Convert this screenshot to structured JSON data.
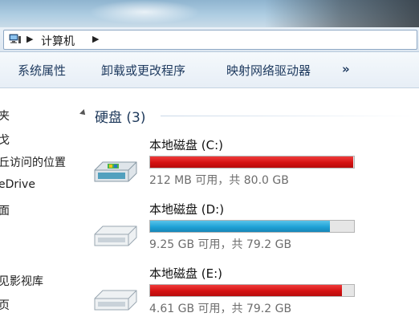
{
  "address": {
    "crumbs": [
      "计算机"
    ]
  },
  "toolbar": {
    "items": [
      "系统属性",
      "卸载或更改程序",
      "映射网络驱动器",
      "»"
    ]
  },
  "nav": {
    "items": [
      "夹",
      "戈",
      "丘访问的位置",
      "eDrive",
      "面",
      "见影视库",
      "页"
    ]
  },
  "group": {
    "title": "硬盘 (3)"
  },
  "drives": [
    {
      "name": "本地磁盘 (C:)",
      "space": "212 MB 可用，共 80.0 GB",
      "used_fraction": 0.997,
      "color": "#d41212"
    },
    {
      "name": "本地磁盘 (D:)",
      "space": "9.25 GB 可用，共 79.2 GB",
      "used_fraction": 0.883,
      "color": "#1fa2d6"
    },
    {
      "name": "本地磁盘 (E:)",
      "space": "4.61 GB 可用，共 79.2 GB",
      "used_fraction": 0.942,
      "color": "#d41212"
    }
  ]
}
